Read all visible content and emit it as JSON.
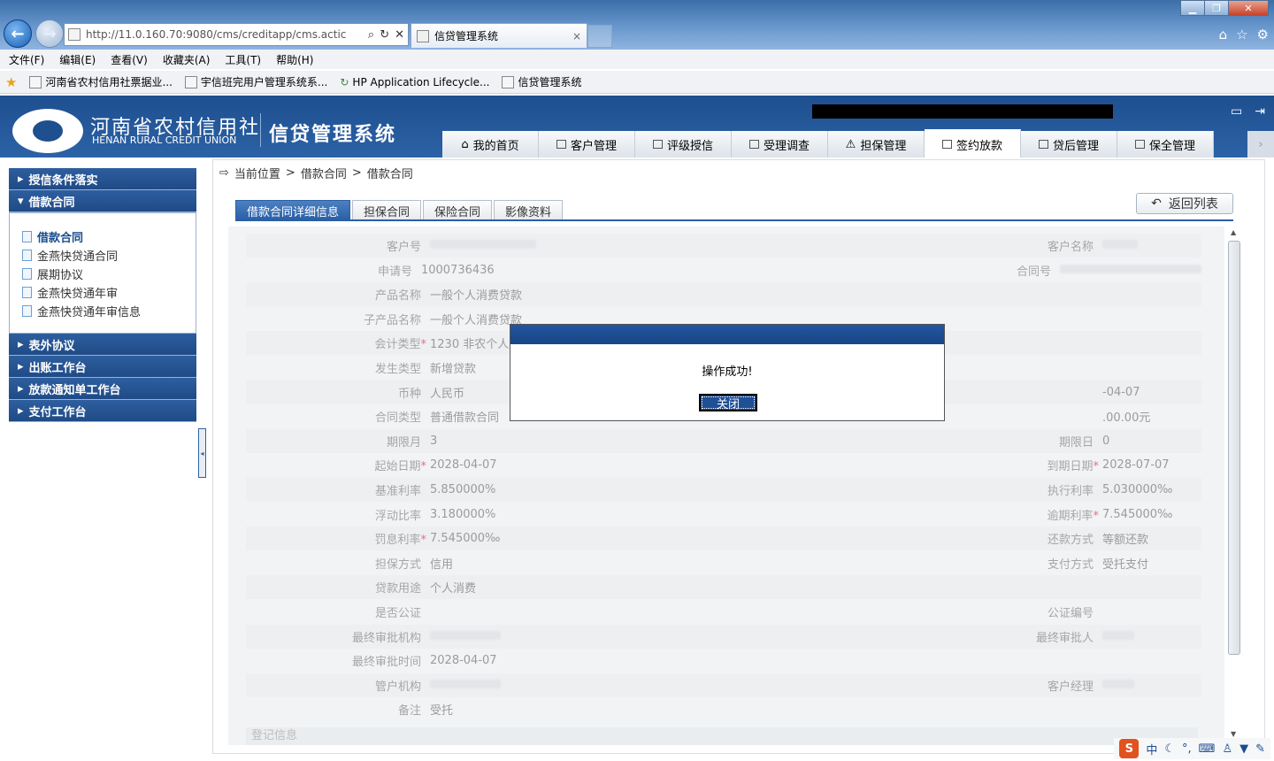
{
  "browser": {
    "address": "http://11.0.160.70:9080/cms/creditapp/cms.actic",
    "address_host": "11.0.160.70",
    "tab_title": "信贷管理系统",
    "tab_close": "×",
    "menu": [
      "文件(F)",
      "编辑(E)",
      "查看(V)",
      "收藏夹(A)",
      "工具(T)",
      "帮助(H)"
    ],
    "favorites": [
      "河南省农村信用社票据业...",
      "宇信班完用户管理系统系...",
      "HP Application Lifecycle...",
      "信贷管理系统"
    ]
  },
  "header": {
    "logo_cn": "河南省农村信用社",
    "logo_en": "HENAN RURAL CREDIT UNION",
    "system_name": "信贷管理系统",
    "nav": [
      "我的首页",
      "客户管理",
      "评级授信",
      "受理调查",
      "担保管理",
      "签约放款",
      "贷后管理",
      "保全管理"
    ],
    "active_nav": "签约放款"
  },
  "sidebar": {
    "groups_top": [
      "授信条件落实",
      "借款合同"
    ],
    "items": [
      "借款合同",
      "金燕快贷通合同",
      "展期协议",
      "金燕快贷通年审",
      "金燕快贷通年审信息"
    ],
    "groups_bottom": [
      "表外协议",
      "出账工作台",
      "放款通知单工作台",
      "支付工作台"
    ]
  },
  "breadcrumb": {
    "prefix": "当前位置",
    "sep": ">",
    "level1": "借款合同",
    "level2": "借款合同"
  },
  "tabs": [
    "借款合同详细信息",
    "担保合同",
    "保险合同",
    "影像资料"
  ],
  "back_button": "返回列表",
  "form": {
    "rows": [
      {
        "l1": "客户号",
        "v1": "",
        "l2": "客户名称",
        "v2": ""
      },
      {
        "l1": "申请号",
        "v1": "1000736436",
        "l2": "合同号",
        "v2": ""
      },
      {
        "l1": "产品名称",
        "v1": "一般个人消费贷款",
        "l2": "",
        "v2": ""
      },
      {
        "l1": "子产品名称",
        "v1": "一般个人消费贷款",
        "l2": "",
        "v2": ""
      },
      {
        "l1": "会计类型",
        "v1": "1230 非农个人",
        "l2": "",
        "v2": ""
      },
      {
        "l1": "发生类型",
        "v1": "新增贷款",
        "l2": "",
        "v2": ""
      },
      {
        "l1": "币种",
        "v1": "人民币",
        "l2": "",
        "v2": "-04-07"
      },
      {
        "l1": "合同类型",
        "v1": "普通借款合同",
        "l2": "",
        "v2": ".00.00元"
      },
      {
        "l1": "期限月",
        "v1": "3",
        "l2": "期限日",
        "v2": "0"
      },
      {
        "l1": "起始日期",
        "v1": "2028-04-07",
        "l2": "到期日期",
        "v2": "2028-07-07"
      },
      {
        "l1": "基准利率",
        "v1": "5.850000%",
        "l2": "执行利率",
        "v2": "5.030000‰"
      },
      {
        "l1": "浮动比率",
        "v1": "3.180000%",
        "l2": "逾期利率",
        "v2": "7.545000‰"
      },
      {
        "l1": "罚息利率",
        "v1": "7.545000‰",
        "l2": "还款方式",
        "v2": "等额还款"
      },
      {
        "l1": "担保方式",
        "v1": "信用",
        "l2": "支付方式",
        "v2": "受托支付"
      },
      {
        "l1": "贷款用途",
        "v1": "个人消费",
        "l2": "",
        "v2": ""
      },
      {
        "l1": "是否公证",
        "v1": "",
        "l2": "公证编号",
        "v2": ""
      },
      {
        "l1": "最终审批机构",
        "v1": "",
        "l2": "最终审批人",
        "v2": ""
      },
      {
        "l1": "最终审批时间",
        "v1": "2028-04-07",
        "l2": "",
        "v2": ""
      },
      {
        "l1": "管户机构",
        "v1": "",
        "l2": "客户经理",
        "v2": ""
      },
      {
        "l1": "备注",
        "v1": "受托",
        "l2": "",
        "v2": ""
      }
    ],
    "section": "登记信息"
  },
  "dialog": {
    "message": "操作成功!",
    "button": "关闭"
  },
  "tray": {
    "ime": "中"
  }
}
